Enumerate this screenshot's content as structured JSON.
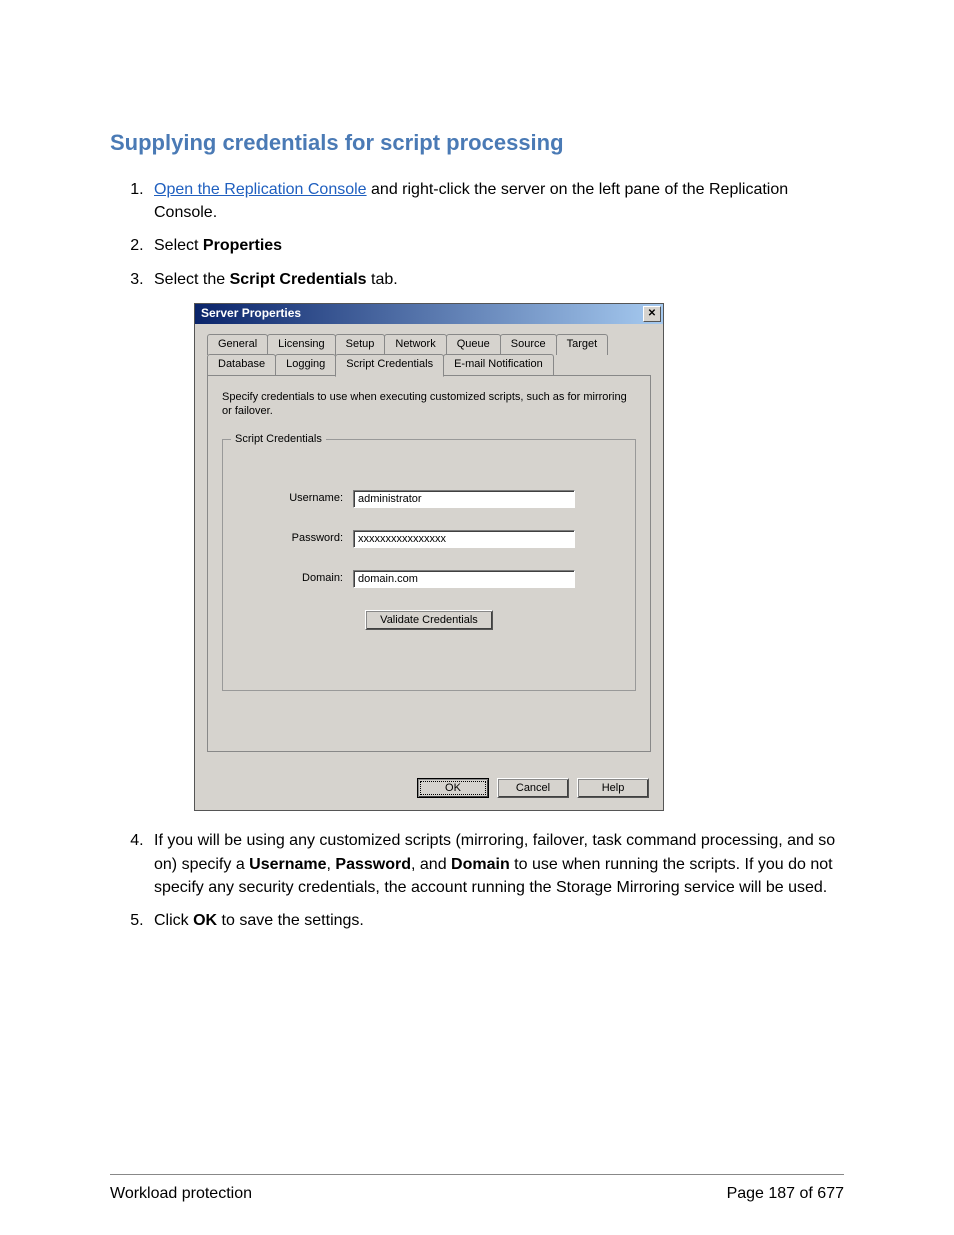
{
  "heading": "Supplying credentials for script processing",
  "steps": {
    "s1_link": "Open the Replication Console",
    "s1_rest": " and right-click the server on the left pane of the Replication Console.",
    "s2_pre": "Select ",
    "s2_bold": "Properties",
    "s3_pre": "Select the ",
    "s3_bold": "Script Credentials",
    "s3_post": " tab.",
    "s4_pre": "If you will be using any customized scripts (mirroring, failover, task command processing, and so on) specify a ",
    "s4_b1": "Username",
    "s4_m1": ", ",
    "s4_b2": "Password",
    "s4_m2": ", and ",
    "s4_b3": "Domain",
    "s4_post": " to use when running the scripts. If you do not specify any security credentials, the account running the Storage Mirroring service will be used.",
    "s5_pre": "Click ",
    "s5_bold": "OK",
    "s5_post": " to save the settings."
  },
  "dialog": {
    "title": "Server Properties",
    "tabs_row1": [
      "General",
      "Licensing",
      "Setup",
      "Network",
      "Queue",
      "Source",
      "Target"
    ],
    "tabs_row2": [
      "Database",
      "Logging",
      "Script Credentials",
      "E-mail Notification"
    ],
    "active_tab": "Script Credentials",
    "instruction": "Specify credentials to use when executing customized scripts, such as for mirroring or failover.",
    "group_legend": "Script Credentials",
    "username_label": "Username:",
    "username_value": "administrator",
    "password_label": "Password:",
    "password_value": "xxxxxxxxxxxxxxxx",
    "domain_label": "Domain:",
    "domain_value": "domain.com",
    "validate_btn": "Validate Credentials",
    "ok": "OK",
    "cancel": "Cancel",
    "help": "Help"
  },
  "footer": {
    "left": "Workload protection",
    "right": "Page 187 of 677"
  }
}
